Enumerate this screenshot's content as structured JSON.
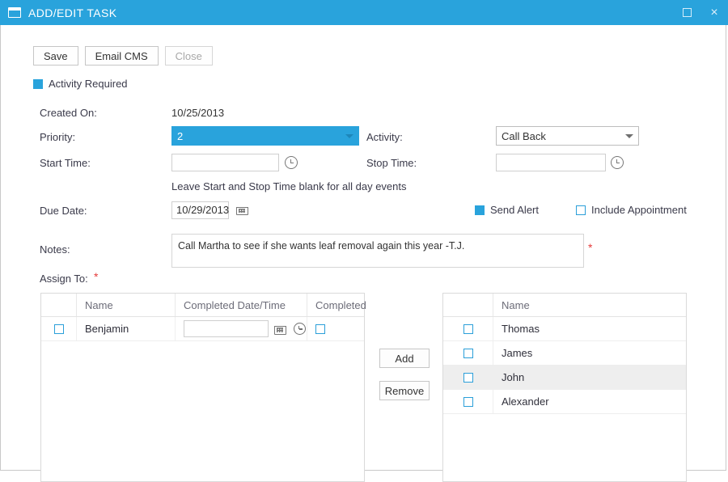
{
  "window": {
    "title": "ADD/EDIT TASK",
    "icon": "window-icon",
    "maximize_label": "",
    "close_label": "×"
  },
  "toolbar": {
    "save_label": "Save",
    "email_cms_label": "Email CMS",
    "close_label": "Close"
  },
  "activity_required": {
    "label": "Activity Required",
    "checked": true
  },
  "form": {
    "created_on_label": "Created On:",
    "created_on_value": "10/25/2013",
    "priority_label": "Priority:",
    "priority_value": "2",
    "activity_label": "Activity:",
    "activity_value": "Call Back",
    "start_time_label": "Start Time:",
    "start_time_value": "",
    "stop_time_label": "Stop Time:",
    "stop_time_value": "",
    "hint": "Leave Start and Stop Time blank for all day events",
    "due_date_label": "Due Date:",
    "due_date_value": "10/29/2013",
    "send_alert_label": "Send Alert",
    "send_alert_checked": true,
    "include_appointment_label": "Include Appointment",
    "include_appointment_checked": false,
    "notes_label": "Notes:",
    "notes_value": "Call Martha to see if she wants leaf removal again this year -T.J.",
    "notes_required_mark": "*",
    "assign_to_label": "Assign To:",
    "assign_to_required_mark": "*"
  },
  "assigned_grid": {
    "headers": [
      "",
      "Name",
      "Completed Date/Time",
      "Completed"
    ],
    "rows": [
      {
        "selected": false,
        "name": "Benjamin",
        "completed_datetime": "",
        "completed": false
      }
    ]
  },
  "middle_buttons": {
    "add_label": "Add",
    "remove_label": "Remove"
  },
  "available_grid": {
    "headers": [
      "",
      "Name"
    ],
    "rows": [
      {
        "selected": false,
        "name": "Thomas",
        "highlighted": false
      },
      {
        "selected": false,
        "name": "James",
        "highlighted": false
      },
      {
        "selected": false,
        "name": "John",
        "highlighted": true
      },
      {
        "selected": false,
        "name": "Alexander",
        "highlighted": false
      }
    ]
  },
  "colors": {
    "accent": "#29a3dc",
    "required": "#e53b3b",
    "row_highlight": "#eeeeee"
  }
}
